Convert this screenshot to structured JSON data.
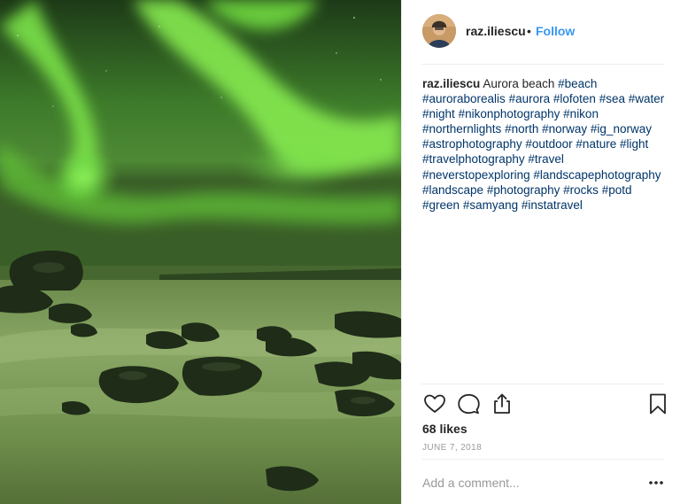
{
  "post": {
    "username": "raz.iliescu",
    "separator": "•",
    "follow_label": "Follow",
    "caption": {
      "username": "raz.iliescu",
      "text": "Aurora beach",
      "hashtags": [
        "#beach",
        "#auroraborealis",
        "#aurora",
        "#lofoten",
        "#sea",
        "#water",
        "#night",
        "#nikonphotography",
        "#nikon",
        "#northernlights",
        "#north",
        "#norway",
        "#ig_norway",
        "#astrophotography",
        "#outdoor",
        "#nature",
        "#light",
        "#travelphotography",
        "#travel",
        "#neverstopexploring",
        "#landscapephotography",
        "#landscape",
        "#photography",
        "#rocks",
        "#potd",
        "#green",
        "#samyang",
        "#instatravel"
      ]
    },
    "actions": {
      "like_icon": "heart-icon",
      "comment_icon": "speech-bubble-icon",
      "share_icon": "share-icon",
      "save_icon": "bookmark-icon"
    },
    "likes": "68 likes",
    "date": "JUNE 7, 2018",
    "comment_placeholder": "Add a comment...",
    "more_icon": "more-options-icon",
    "colors": {
      "accent_blue": "#3897f0",
      "hashtag_blue": "#003569",
      "text": "#262626",
      "muted": "#999999",
      "divider": "#efefef",
      "aurora_green": "#5fd23a"
    }
  }
}
